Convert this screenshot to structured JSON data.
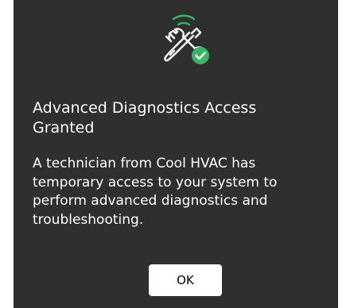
{
  "dialog": {
    "icon": "wrench-screwdriver-wireless-check-icon",
    "title": "Advanced Diagnostics Access Granted",
    "message": "A technician from Cool HVAC has temporary access to your system to perform advanced diagnostics and troubleshooting.",
    "ok_label": "OK"
  },
  "colors": {
    "background": "#2f2f2f",
    "accent_green": "#35b85f",
    "text": "#ffffff",
    "button_bg": "#ffffff"
  }
}
